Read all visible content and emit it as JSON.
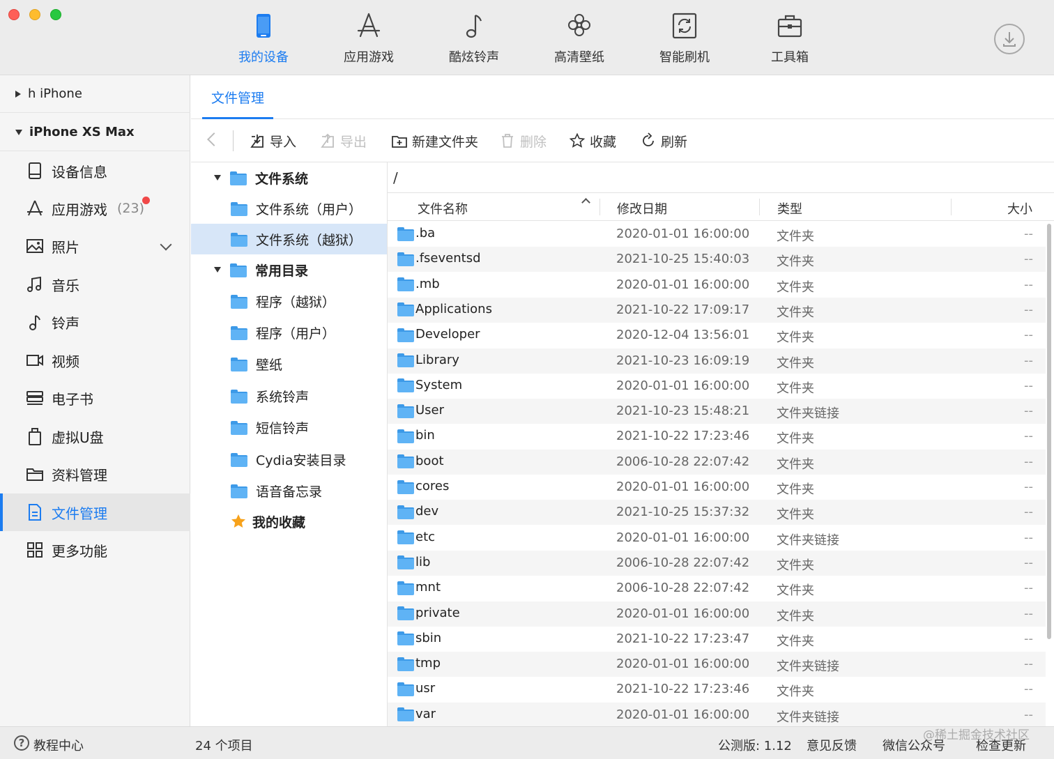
{
  "nav": {
    "items": [
      {
        "label": "我的设备",
        "icon": "phone-icon",
        "active": true
      },
      {
        "label": "应用游戏",
        "icon": "app-store-icon",
        "active": false
      },
      {
        "label": "酷炫铃声",
        "icon": "music-note-icon",
        "active": false
      },
      {
        "label": "高清壁纸",
        "icon": "flower-icon",
        "active": false
      },
      {
        "label": "智能刷机",
        "icon": "refresh-box-icon",
        "active": false
      },
      {
        "label": "工具箱",
        "icon": "toolbox-icon",
        "active": false
      }
    ],
    "download_icon": "download-icon",
    "accent_color": "#1c7cf0"
  },
  "sidebar": {
    "devices": [
      {
        "label": "h iPhone",
        "expanded": false
      },
      {
        "label": "iPhone XS Max",
        "expanded": true
      }
    ],
    "items": [
      {
        "label": "设备信息",
        "icon": "device-info-icon"
      },
      {
        "label": "应用游戏",
        "icon": "apps-icon",
        "count": "(23)"
      },
      {
        "label": "照片",
        "icon": "photo-icon"
      },
      {
        "label": "音乐",
        "icon": "music-icon"
      },
      {
        "label": "铃声",
        "icon": "ringtone-icon"
      },
      {
        "label": "视频",
        "icon": "video-icon"
      },
      {
        "label": "电子书",
        "icon": "ebook-icon"
      },
      {
        "label": "虚拟U盘",
        "icon": "usb-drive-icon"
      },
      {
        "label": "资料管理",
        "icon": "folder-icon"
      },
      {
        "label": "文件管理",
        "icon": "file-icon",
        "active": true
      },
      {
        "label": "更多功能",
        "icon": "grid-icon"
      }
    ]
  },
  "main": {
    "tab": "文件管理"
  },
  "toolbar": {
    "import": "导入",
    "export": "导出",
    "new_folder": "新建文件夹",
    "delete": "删除",
    "favorite": "收藏",
    "refresh": "刷新"
  },
  "tree": {
    "items": [
      {
        "label": "文件系统",
        "level": 0,
        "bold": true
      },
      {
        "label": "文件系统（用户）",
        "level": 1
      },
      {
        "label": "文件系统（越狱）",
        "level": 1,
        "selected": true
      },
      {
        "label": "常用目录",
        "level": 0,
        "bold": true
      },
      {
        "label": "程序（越狱）",
        "level": 1
      },
      {
        "label": "程序（用户）",
        "level": 1
      },
      {
        "label": "壁纸",
        "level": 1
      },
      {
        "label": "系统铃声",
        "level": 1
      },
      {
        "label": "短信铃声",
        "level": 1
      },
      {
        "label": "Cydia安装目录",
        "level": 1
      },
      {
        "label": "语音备忘录",
        "level": 1
      },
      {
        "label": "我的收藏",
        "level": 0,
        "bold": true,
        "icon": "star-icon"
      }
    ]
  },
  "filelist": {
    "path": "/",
    "columns": {
      "name": "文件名称",
      "date": "修改日期",
      "type": "类型",
      "size": "大小"
    },
    "rows": [
      {
        "name": ".ba",
        "date": "2020-01-01 16:00:00",
        "type": "文件夹",
        "size": "--"
      },
      {
        "name": ".fseventsd",
        "date": "2021-10-25 15:40:03",
        "type": "文件夹",
        "size": "--"
      },
      {
        "name": ".mb",
        "date": "2020-01-01 16:00:00",
        "type": "文件夹",
        "size": "--"
      },
      {
        "name": "Applications",
        "date": "2021-10-22 17:09:17",
        "type": "文件夹",
        "size": "--"
      },
      {
        "name": "Developer",
        "date": "2020-12-04 13:56:01",
        "type": "文件夹",
        "size": "--"
      },
      {
        "name": "Library",
        "date": "2021-10-23 16:09:19",
        "type": "文件夹",
        "size": "--"
      },
      {
        "name": "System",
        "date": "2020-01-01 16:00:00",
        "type": "文件夹",
        "size": "--"
      },
      {
        "name": "User",
        "date": "2021-10-23 15:48:21",
        "type": "文件夹链接",
        "size": "--"
      },
      {
        "name": "bin",
        "date": "2021-10-22 17:23:46",
        "type": "文件夹",
        "size": "--"
      },
      {
        "name": "boot",
        "date": "2006-10-28 22:07:42",
        "type": "文件夹",
        "size": "--"
      },
      {
        "name": "cores",
        "date": "2020-01-01 16:00:00",
        "type": "文件夹",
        "size": "--"
      },
      {
        "name": "dev",
        "date": "2021-10-25 15:37:32",
        "type": "文件夹",
        "size": "--"
      },
      {
        "name": "etc",
        "date": "2020-01-01 16:00:00",
        "type": "文件夹链接",
        "size": "--"
      },
      {
        "name": "lib",
        "date": "2006-10-28 22:07:42",
        "type": "文件夹",
        "size": "--"
      },
      {
        "name": "mnt",
        "date": "2006-10-28 22:07:42",
        "type": "文件夹",
        "size": "--"
      },
      {
        "name": "private",
        "date": "2020-01-01 16:00:00",
        "type": "文件夹",
        "size": "--"
      },
      {
        "name": "sbin",
        "date": "2021-10-22 17:23:47",
        "type": "文件夹",
        "size": "--"
      },
      {
        "name": "tmp",
        "date": "2020-01-01 16:00:00",
        "type": "文件夹链接",
        "size": "--"
      },
      {
        "name": "usr",
        "date": "2021-10-22 17:23:46",
        "type": "文件夹",
        "size": "--"
      },
      {
        "name": "var",
        "date": "2020-01-01 16:00:00",
        "type": "文件夹链接",
        "size": "--"
      }
    ]
  },
  "status": {
    "help": "教程中心",
    "count": "24 个项目",
    "version": "公测版: 1.12",
    "feedback": "意见反馈",
    "wechat": "微信公众号",
    "update": "检查更新",
    "watermark": "@稀土掘金技术社区"
  }
}
